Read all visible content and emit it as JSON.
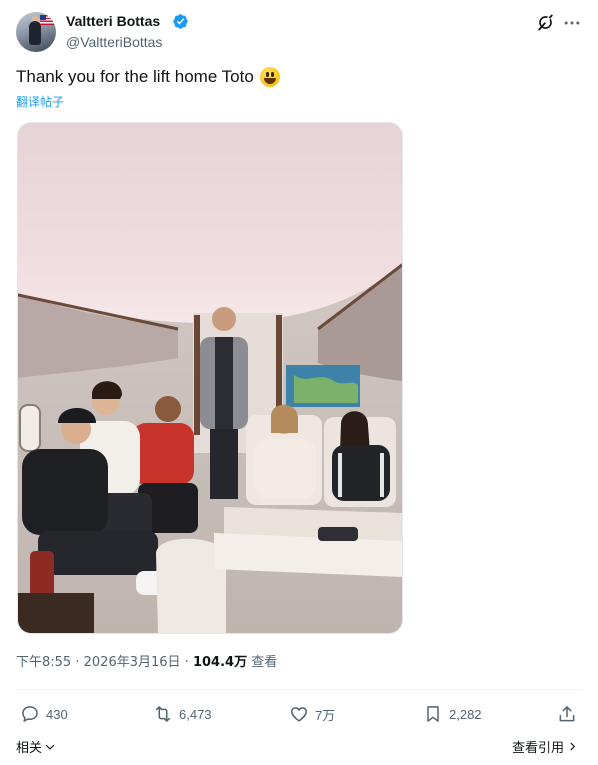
{
  "author": {
    "display_name": "Valtteri Bottas",
    "handle": "@ValtteriBottas",
    "avatar_icon": "avatar-with-us-flag",
    "verified_color": "#1d9bf0"
  },
  "header_icons": [
    "grok-icon",
    "more-icon"
  ],
  "tweet": {
    "text": "Thank you for the lift home Toto",
    "emoji_icon": "grinning-face-emoji",
    "translate_label": "翻译帖子"
  },
  "meta": {
    "time": "下午8:55",
    "date": "2026年3月16日",
    "separator": "·",
    "views_count": "104.4万",
    "views_label": "查看"
  },
  "actions": {
    "replies": "430",
    "reposts": "6,473",
    "likes": "7万",
    "bookmarks": "2,282"
  },
  "footer": {
    "related_label": "相关",
    "quotes_label": "查看引用"
  },
  "colors": {
    "accent": "#1d9bf0",
    "text_primary": "#0f1419",
    "text_secondary": "#536471"
  }
}
